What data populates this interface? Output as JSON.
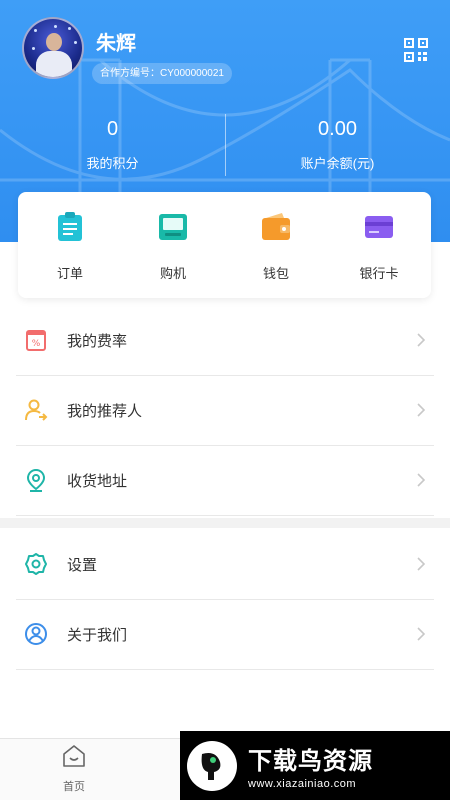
{
  "profile": {
    "name": "朱辉",
    "partner_label": "合作方编号：",
    "partner_id": "CY000000021"
  },
  "stats": [
    {
      "value": "0",
      "label": "我的积分"
    },
    {
      "value": "0.00",
      "label": "账户余额(元)"
    }
  ],
  "quick_actions": [
    {
      "label": "订单",
      "icon": "clipboard-icon",
      "color": "#23c2d6"
    },
    {
      "label": "购机",
      "icon": "pos-machine-icon",
      "color": "#19b9a8"
    },
    {
      "label": "钱包",
      "icon": "wallet-icon",
      "color": "#f59a2b"
    },
    {
      "label": "银行卡",
      "icon": "bank-card-icon",
      "color": "#8a5df0"
    }
  ],
  "menu": [
    {
      "label": "我的费率",
      "icon": "rate-icon"
    },
    {
      "label": "我的推荐人",
      "icon": "referrer-icon"
    },
    {
      "label": "收货地址",
      "icon": "location-icon"
    },
    {
      "label": "设置",
      "icon": "settings-icon"
    },
    {
      "label": "关于我们",
      "icon": "about-icon"
    }
  ],
  "bottom_nav": {
    "home_label": "首页"
  },
  "watermark": {
    "title": "下载鸟资源",
    "url": "www.xiazainiao.com"
  },
  "colors": {
    "header_blue": "#3f9ef7",
    "menu_rate": "#f26d6d",
    "menu_referrer": "#f5b942",
    "menu_teal": "#1fb5a8",
    "menu_about": "#3d8ee9"
  }
}
